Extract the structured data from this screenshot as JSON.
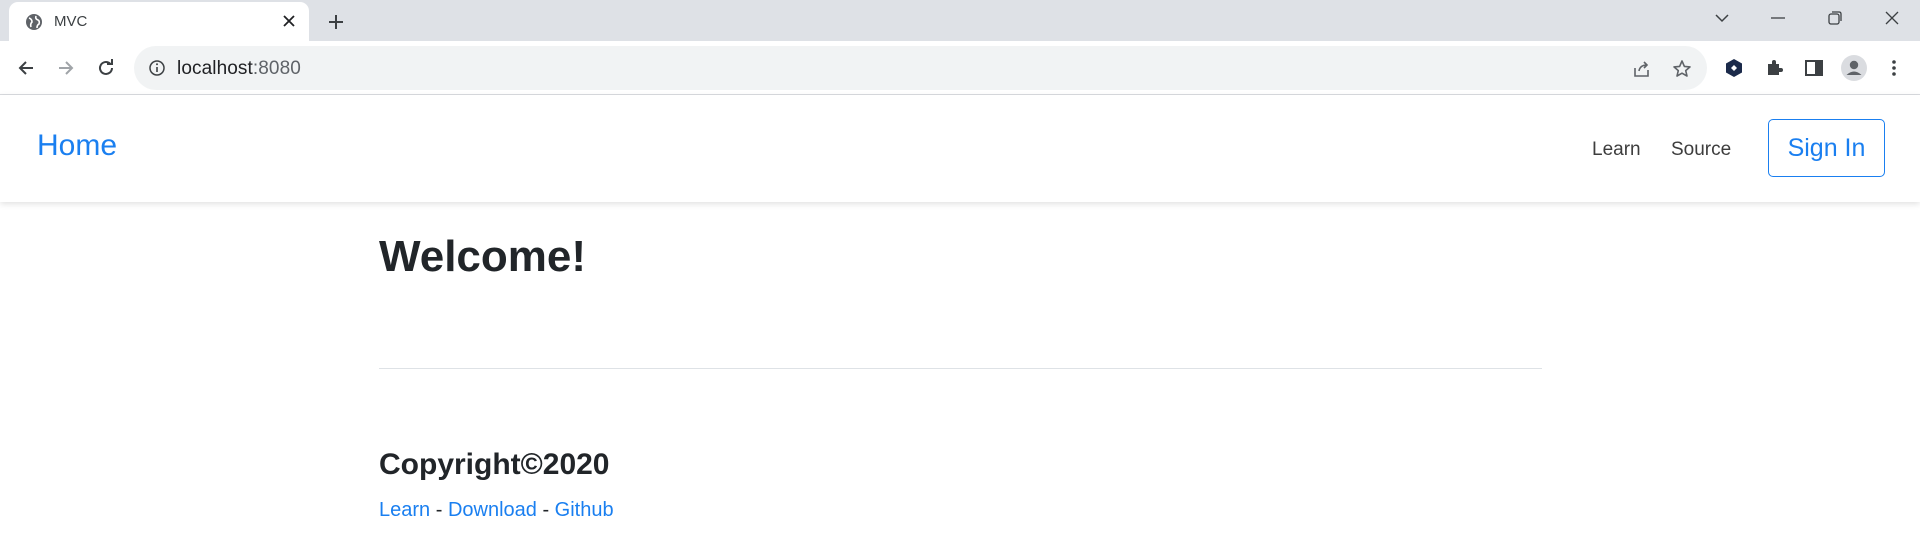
{
  "browser": {
    "tab_title": "MVC",
    "url_host": "localhost",
    "url_port": ":8080"
  },
  "navbar": {
    "brand": "Home",
    "links": [
      "Learn",
      "Source"
    ],
    "signin": "Sign In"
  },
  "main": {
    "heading": "Welcome!"
  },
  "footer": {
    "copyright": "Copyright©2020",
    "links": [
      "Learn",
      "Download",
      "Github"
    ],
    "separator": " - "
  },
  "colors": {
    "accent": "#1a7ff0",
    "text": "#212529",
    "tabstrip": "#dee1e6",
    "omnibox": "#f1f3f4"
  },
  "icons": [
    "globe-icon",
    "close-icon",
    "plus-icon",
    "chevron-down-icon",
    "minimize-icon",
    "restore-icon",
    "window-close-icon",
    "back-arrow-icon",
    "forward-arrow-icon",
    "reload-icon",
    "info-icon",
    "share-icon",
    "star-icon",
    "extension-badge-icon",
    "puzzle-icon",
    "side-panel-icon",
    "profile-icon",
    "kebab-menu-icon"
  ]
}
